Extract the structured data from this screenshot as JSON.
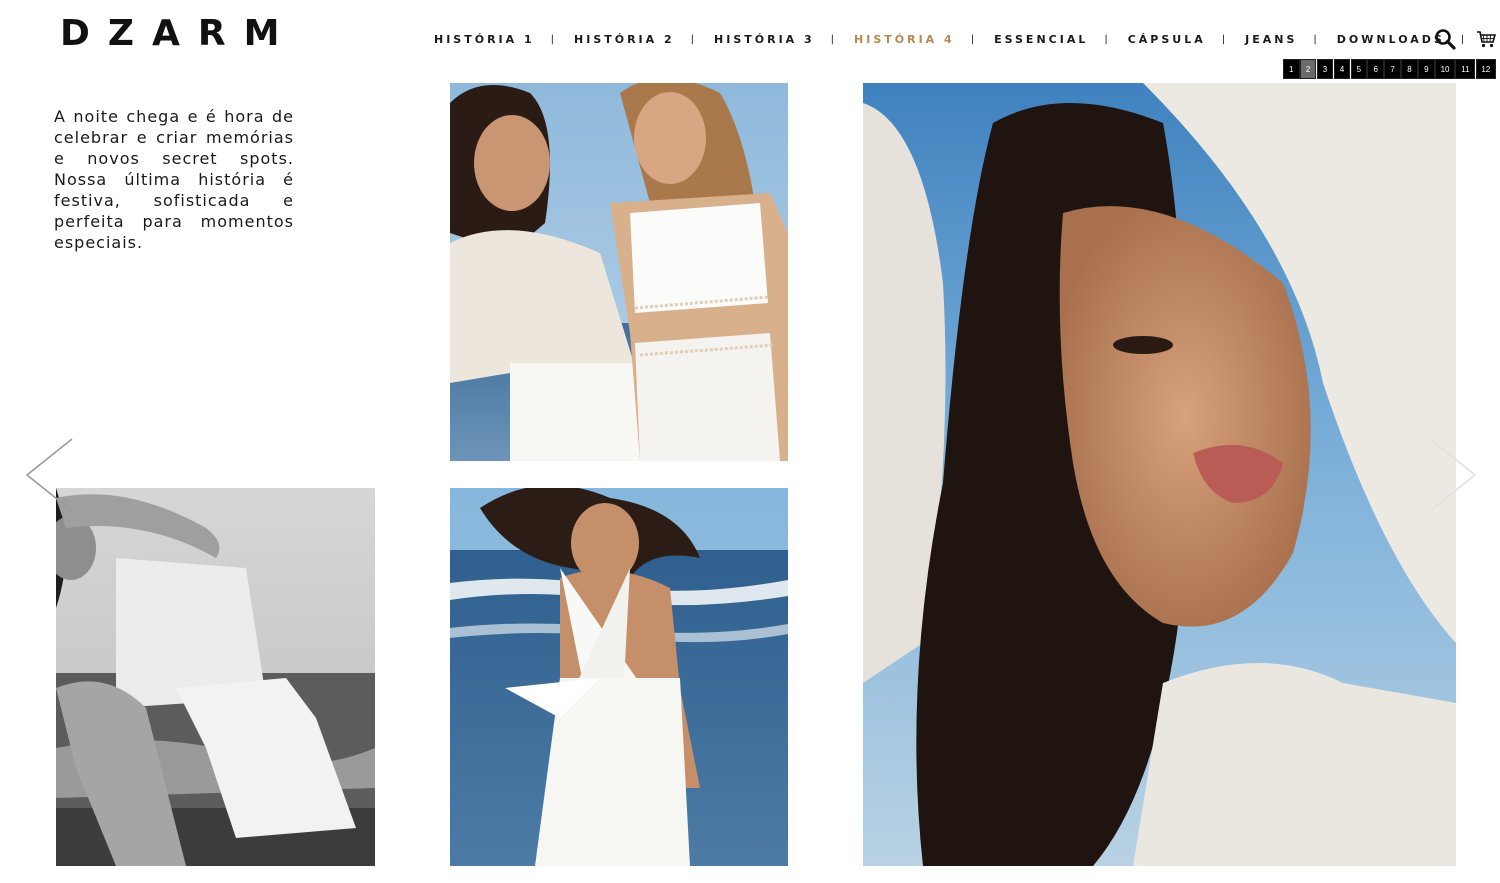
{
  "brand": {
    "logo": "DZARM"
  },
  "nav": {
    "items": [
      {
        "label": "HISTÓRIA 1",
        "active": false
      },
      {
        "label": "HISTÓRIA 2",
        "active": false
      },
      {
        "label": "HISTÓRIA 3",
        "active": false
      },
      {
        "label": "HISTÓRIA 4",
        "active": true
      },
      {
        "label": "ESSENCIAL",
        "active": false
      },
      {
        "label": "CÁPSULA",
        "active": false
      },
      {
        "label": "JEANS",
        "active": false
      },
      {
        "label": "DOWNLOADS",
        "active": false
      }
    ],
    "separator": "|"
  },
  "icons": {
    "search": "search-icon",
    "cart": "cart-icon",
    "prev": "chevron-left-icon",
    "next": "chevron-right-icon"
  },
  "pager": {
    "pages": [
      "1",
      "2",
      "3",
      "4",
      "5",
      "6",
      "7",
      "8",
      "9",
      "10",
      "11",
      "12"
    ],
    "current": "2"
  },
  "intro": {
    "text": "A noite chega e é hora de celebrar e criar memórias e novos secret spots. Nossa última história é festiva, sofisticada e perfeita para momentos especiais."
  },
  "colors": {
    "accent": "#b8894e",
    "text": "#111111",
    "pager_bg": "#000000",
    "pager_active": "#6b6b6b"
  }
}
